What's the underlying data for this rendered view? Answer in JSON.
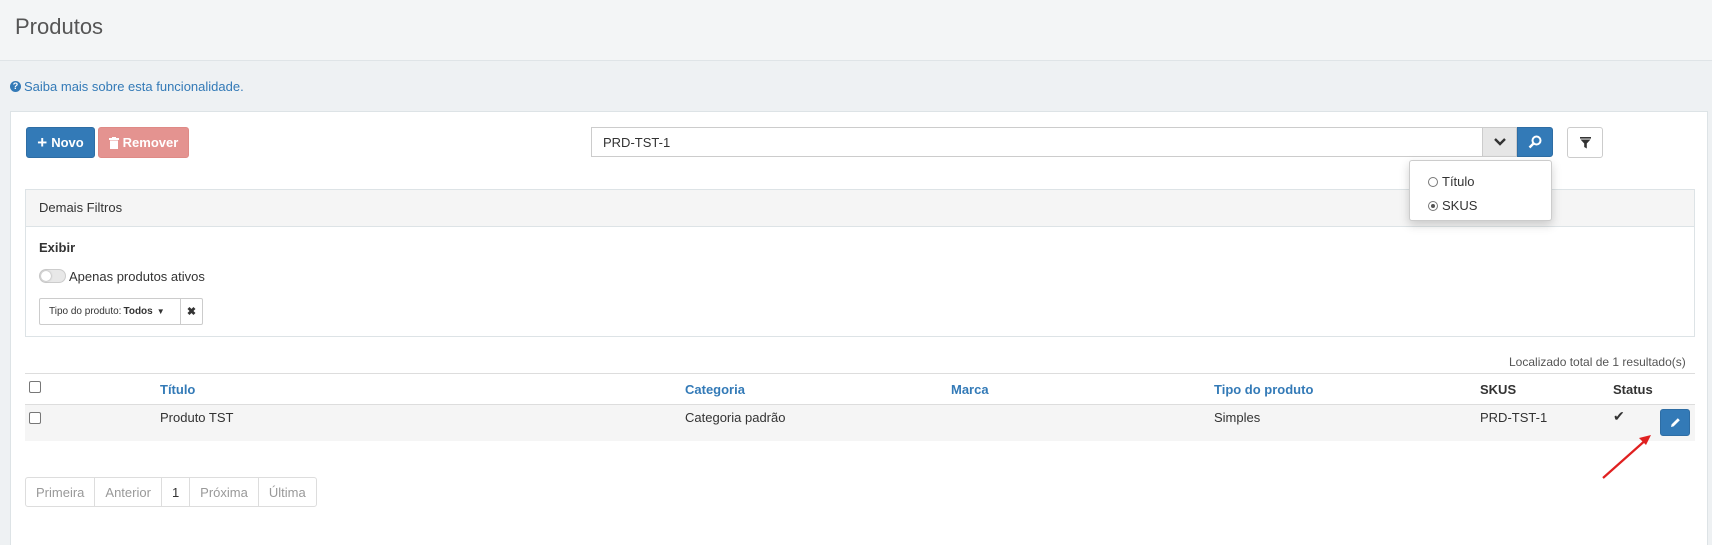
{
  "header": {
    "title": "Produtos"
  },
  "help": {
    "text": "Saiba mais sobre esta funcionalidade."
  },
  "toolbar": {
    "new_label": "Novo",
    "remove_label": "Remover"
  },
  "search": {
    "value": "PRD-TST-1"
  },
  "search_mode_menu": {
    "options": [
      {
        "label": "Título",
        "selected": false
      },
      {
        "label": "SKUS",
        "selected": true
      }
    ]
  },
  "filters": {
    "title": "Demais Filtros",
    "section_label": "Exibir",
    "active_only_label": "Apenas produtos ativos",
    "active_only_enabled": false,
    "product_type_label": "Tipo do produto:",
    "product_type_value": "Todos"
  },
  "results": {
    "count_text": "Localizado total de 1 resultado(s)"
  },
  "table": {
    "columns": [
      "Título",
      "Categoria",
      "Marca",
      "Tipo do produto",
      "SKUS",
      "Status"
    ],
    "rows": [
      {
        "titulo": "Produto TST",
        "categoria": "Categoria padrão",
        "marca": "",
        "tipo": "Simples",
        "skus": "PRD-TST-1",
        "status": "active"
      }
    ]
  },
  "pagination": {
    "first": "Primeira",
    "prev": "Anterior",
    "current": "1",
    "next": "Próxima",
    "last": "Última"
  },
  "colors": {
    "primary": "#337ab7",
    "danger_muted": "#e49390",
    "annotation": "#e02020"
  }
}
